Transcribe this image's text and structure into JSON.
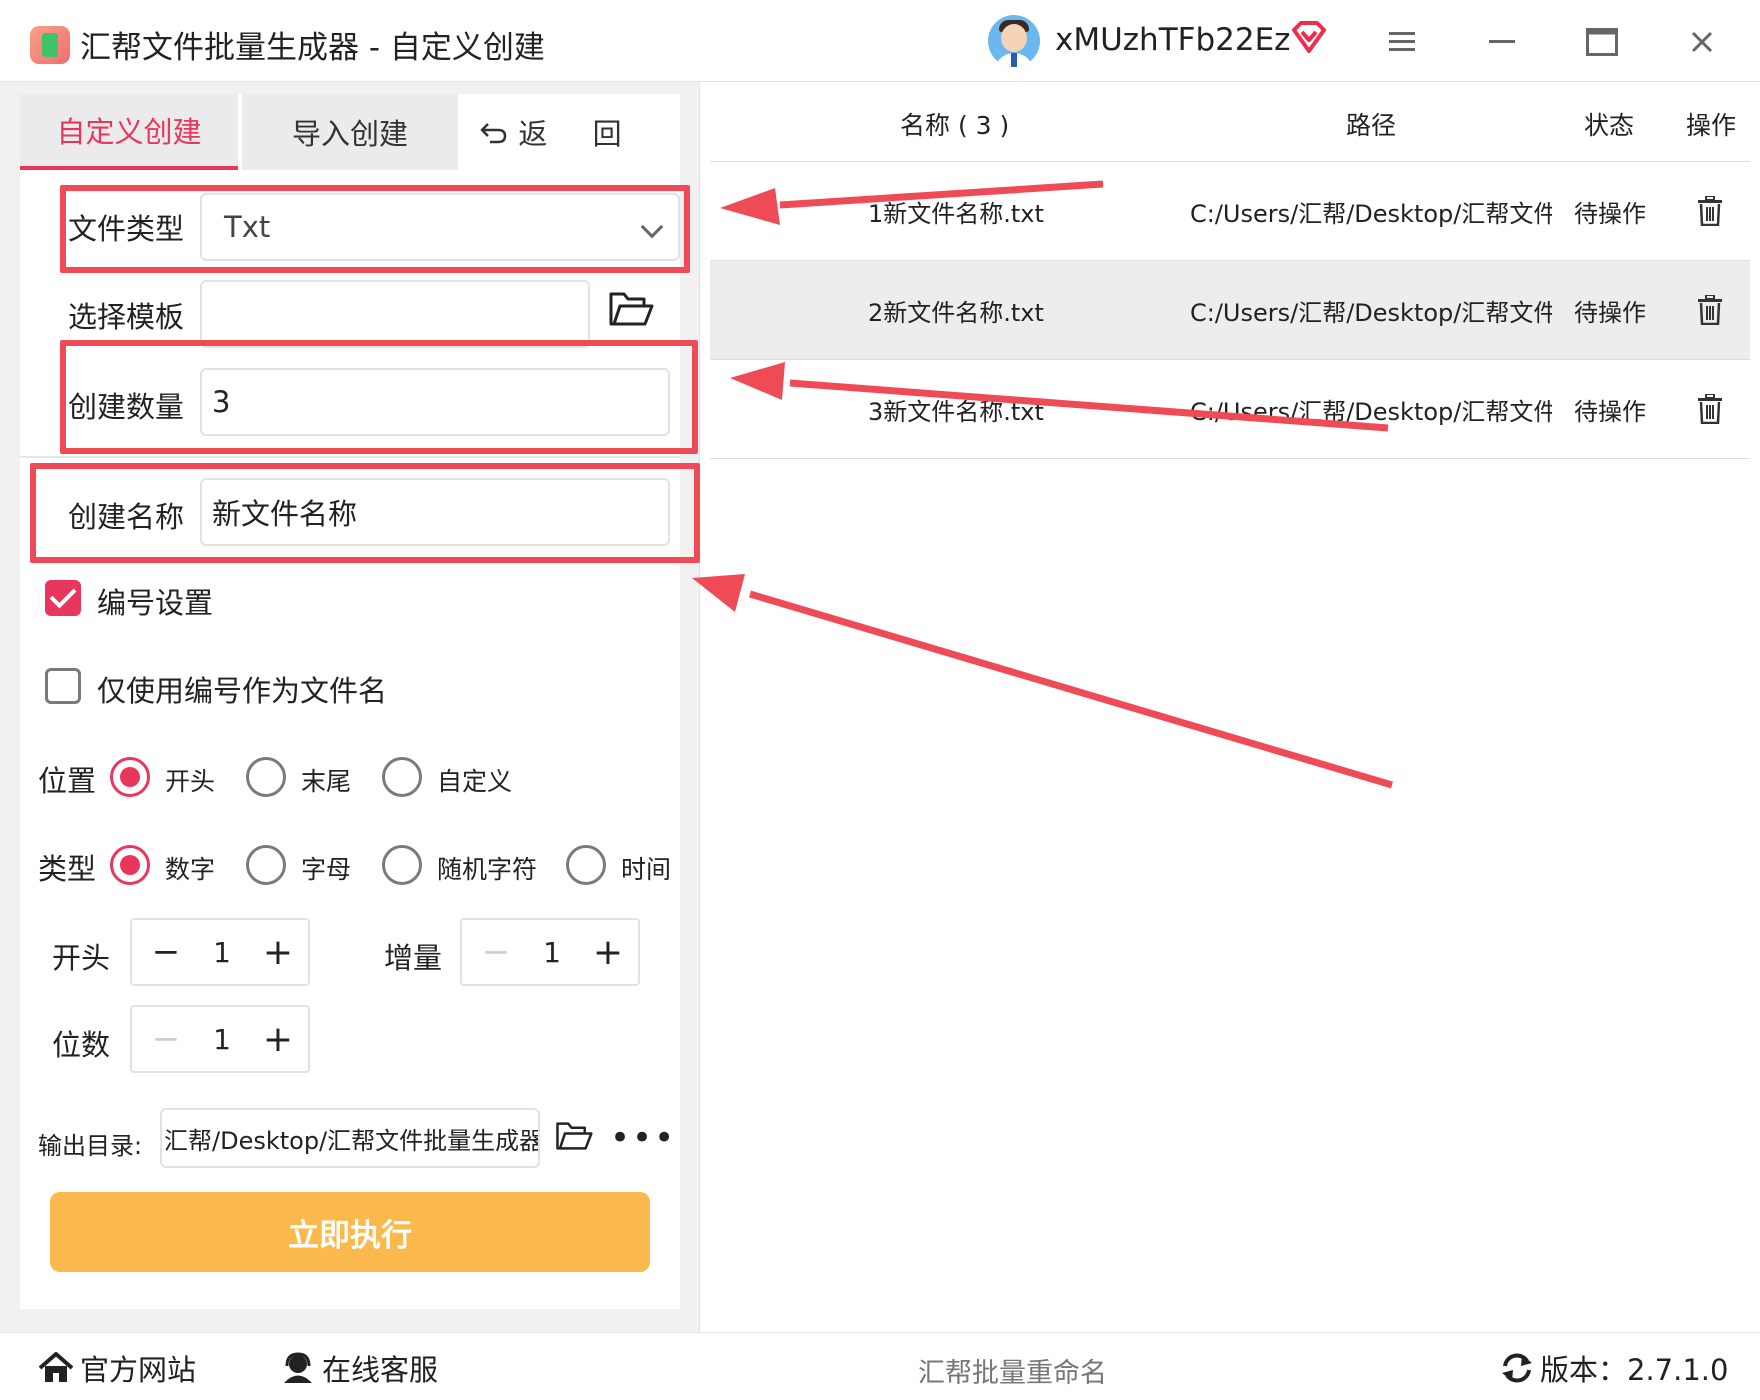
{
  "window": {
    "title": "汇帮文件批量生成器 - 自定义创建",
    "username": "xMUzhTFb22Ez",
    "menu_icon": "menu-icon",
    "minimize_icon": "minimize-icon",
    "maximize_icon": "maximize-icon",
    "close_icon": "close-icon"
  },
  "tabs": {
    "custom": "自定义创建",
    "import": "导入创建",
    "back": "返 回"
  },
  "form": {
    "file_type_label": "文件类型",
    "file_type_value": "Txt",
    "template_label": "选择模板",
    "template_value": "",
    "count_label": "创建数量",
    "count_value": "3",
    "name_label": "创建名称",
    "name_value": "新文件名称",
    "numbering_label": "编号设置",
    "numbering_checked": true,
    "only_number_label": "仅使用编号作为文件名",
    "only_number_checked": false,
    "position_label": "位置",
    "position_options": [
      "开头",
      "末尾",
      "自定义"
    ],
    "position_selected": "开头",
    "type_label": "类型",
    "type_options": [
      "数字",
      "字母",
      "随机字符",
      "时间"
    ],
    "type_selected": "数字",
    "start_label": "开头",
    "start_value": "1",
    "increment_label": "增量",
    "increment_value": "1",
    "digits_label": "位数",
    "digits_value": "1",
    "output_label": "输出目录:",
    "output_value": "汇帮/Desktop/汇帮文件批量生成器",
    "execute_label": "立即执行"
  },
  "table": {
    "headers": [
      "名称 ( 3 )",
      "路径",
      "状态",
      "操作"
    ],
    "rows": [
      {
        "name": "1新文件名称.txt",
        "path": "C:/Users/汇帮/Desktop/汇帮文件",
        "status": "待操作"
      },
      {
        "name": "2新文件名称.txt",
        "path": "C:/Users/汇帮/Desktop/汇帮文件",
        "status": "待操作"
      },
      {
        "name": "3新文件名称.txt",
        "path": "C:/Users/汇帮/Desktop/汇帮文件",
        "status": "待操作"
      }
    ]
  },
  "statusbar": {
    "website": "官方网站",
    "support": "在线客服",
    "center": "汇帮批量重命名",
    "version": "版本：2.7.1.0"
  },
  "colors": {
    "accent": "#e8365d",
    "execute_button": "#fbb84d",
    "annotation": "#ef4b57"
  }
}
